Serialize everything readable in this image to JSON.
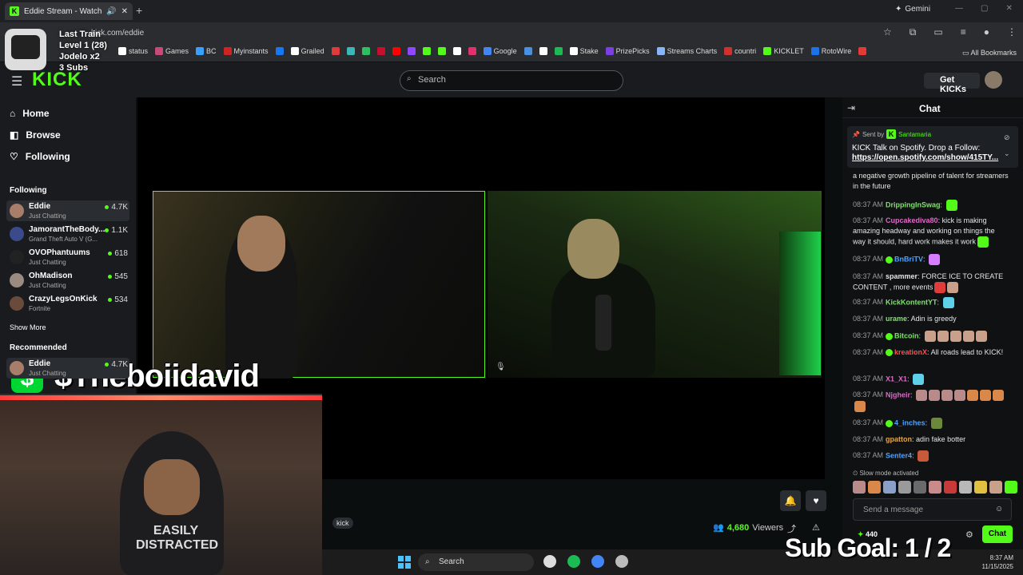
{
  "browser": {
    "tab_title": "Eddie Stream - Watch Live ...",
    "url": "kick.com/eddie",
    "gemini": "Gemini",
    "all_bookmarks": "All Bookmarks",
    "bookmarks": [
      {
        "label": "status",
        "color": "#ffffff"
      },
      {
        "label": "Games",
        "color": "#c84a7a"
      },
      {
        "label": "BC",
        "color": "#3aa0ff"
      },
      {
        "label": "Myinstants",
        "color": "#d02424"
      },
      {
        "label": "",
        "color": "#1877f2"
      },
      {
        "label": "Grailed",
        "color": "#ffffff"
      },
      {
        "label": "",
        "color": "#e03b3b"
      },
      {
        "label": "",
        "color": "#3ab8b8"
      },
      {
        "label": "",
        "color": "#2cc060"
      },
      {
        "label": "",
        "color": "#c8102e"
      },
      {
        "label": "",
        "color": "#ff0000"
      },
      {
        "label": "",
        "color": "#9146ff"
      },
      {
        "label": "",
        "color": "#53fc18"
      },
      {
        "label": "",
        "color": "#53fc18"
      },
      {
        "label": "",
        "color": "#ffffff"
      },
      {
        "label": "",
        "color": "#e1306c"
      },
      {
        "label": "Google",
        "color": "#4285f4"
      },
      {
        "label": "",
        "color": "#4a90e2"
      },
      {
        "label": "",
        "color": "#ffffff"
      },
      {
        "label": "",
        "color": "#1db954"
      },
      {
        "label": "Stake",
        "color": "#ffffff"
      },
      {
        "label": "PrizePicks",
        "color": "#7b3fe4"
      },
      {
        "label": "Streams Charts",
        "color": "#8ab4f8"
      },
      {
        "label": "countri",
        "color": "#d0312d"
      },
      {
        "label": "KICKLET",
        "color": "#53fc18"
      },
      {
        "label": "RotoWire",
        "color": "#1a73e8"
      },
      {
        "label": "",
        "color": "#e53935"
      }
    ]
  },
  "overlay": {
    "line1": "Last Train",
    "line2": "Level 1  (28)",
    "line3": "Jodelo x2",
    "line4": "3 Subs",
    "cashtag_symbol": "$",
    "cashtag": "$Theboiidavid",
    "subgoal": "Sub Goal:  1 / 2",
    "shirt": "EASILY DISTRACTED"
  },
  "header": {
    "logo": "KICK",
    "search_placeholder": "Search",
    "get_kicks": "Get KICKs"
  },
  "sidebar": {
    "nav": [
      {
        "label": "Home",
        "icon": "⌂"
      },
      {
        "label": "Browse",
        "icon": "◧"
      },
      {
        "label": "Following",
        "icon": "♡"
      }
    ],
    "following_title": "Following",
    "following": [
      {
        "name": "Eddie",
        "category": "Just Chatting",
        "viewers": "4.7K",
        "color": "#a87d6a"
      },
      {
        "name": "JamorantTheBody...",
        "category": "Grand Theft Auto V (G...",
        "viewers": "1.1K",
        "color": "#3a4a8a"
      },
      {
        "name": "OVOPhantuums",
        "category": "Just Chatting",
        "viewers": "618",
        "color": "#222"
      },
      {
        "name": "OhMadison",
        "category": "Just Chatting",
        "viewers": "545",
        "color": "#9a8a80"
      },
      {
        "name": "CrazyLegsOnKick",
        "category": "Fortnite",
        "viewers": "534",
        "color": "#6a4a3a"
      }
    ],
    "show_more": "Show More",
    "recommended_title": "Recommended",
    "recommended": [
      {
        "name": "Eddie",
        "category": "Just Chatting",
        "viewers": "4.7K",
        "color": "#a87d6a"
      }
    ]
  },
  "stream": {
    "tag": "kick",
    "viewers": "4,680",
    "viewers_label": "Viewers"
  },
  "chat": {
    "title": "Chat",
    "pinned": {
      "sent_by": "Sent by",
      "user": "Santamaria",
      "message": "KICK Talk on Spotify. Drop a Follow:",
      "link": "https://open.spotify.com/show/415TY..."
    },
    "messages": [
      {
        "time": "08:37 AM",
        "user": "",
        "color": "#ccc",
        "text": "a negative growth pipeline of talent for streamers in the future",
        "badge": false,
        "emotes": []
      },
      {
        "time": "08:37 AM",
        "user": "DrippingInSwag",
        "color": "#7ee36a",
        "text": "",
        "badge": false,
        "emotes": [
          "#53fc18"
        ]
      },
      {
        "time": "08:37 AM",
        "user": "Cupcakediva80",
        "color": "#e067c9",
        "text": "kick is making amazing headway and working on things the way it should, hard work makes it work",
        "badge": false,
        "emotes": [
          "#53fc18"
        ]
      },
      {
        "time": "08:37 AM",
        "user": "BnBriTV",
        "color": "#4fa3ff",
        "text": "",
        "badge": true,
        "emotes": [
          "#d67cff"
        ]
      },
      {
        "time": "08:37 AM",
        "user": "spammer",
        "color": "#e6e6e6",
        "text": "FORCE ICE TO CREATE CONTENT , more events",
        "badge": false,
        "emotes": [
          "#e03b3b",
          "#c9a08a"
        ]
      },
      {
        "time": "08:37 AM",
        "user": "KickKontentYT",
        "color": "#7ee36a",
        "text": "",
        "badge": false,
        "emotes": [
          "#5ed1e8"
        ]
      },
      {
        "time": "08:37 AM",
        "user": "urame",
        "color": "#7ee36a",
        "text": "Adin is greedy",
        "badge": false,
        "emotes": []
      },
      {
        "time": "08:37 AM",
        "user": "Bitcoin",
        "color": "#7ee36a",
        "text": "",
        "badge": true,
        "emotes": [
          "#c9a08a",
          "#c9a08a",
          "#c9a08a",
          "#c9a08a",
          "#c9a08a"
        ]
      },
      {
        "time": "08:37 AM",
        "user": "kreationX",
        "color": "#ff4d4d",
        "text": "All roads lead to KICK!",
        "badge": true,
        "emotes": []
      },
      {
        "time": "08:37 AM",
        "user": "X1_X1",
        "color": "#e067c9",
        "text": "",
        "badge": false,
        "emotes": [
          "#5ed1e8"
        ]
      },
      {
        "time": "08:37 AM",
        "user": "Njgheir",
        "color": "#e067c9",
        "text": "",
        "badge": false,
        "emotes": [
          "#b88a8a",
          "#b88a8a",
          "#b88a8a",
          "#b88a8a",
          "#d9884a",
          "#d9884a",
          "#d9884a",
          "#d9884a"
        ]
      },
      {
        "time": "08:37 AM",
        "user": "4_inches",
        "color": "#4fa3ff",
        "text": "",
        "badge": true,
        "emotes": [
          "#6a8a3a"
        ]
      },
      {
        "time": "08:37 AM",
        "user": "gpatton",
        "color": "#e0a84a",
        "text": "adin fake botter",
        "badge": false,
        "emotes": []
      },
      {
        "time": "08:37 AM",
        "user": "Senter4",
        "color": "#4fa3ff",
        "text": "",
        "badge": false,
        "emotes": [
          "#c85a3a"
        ]
      }
    ],
    "slow_mode": "Slow mode activated",
    "emote_bar": [
      "#b88a8a",
      "#d9884a",
      "#8aa0c8",
      "#9a9a9a",
      "#6a6a6a",
      "#c88a8a",
      "#c83a3a",
      "#b8b8b8",
      "#e0c040",
      "#c9a08a",
      "#53fc18"
    ],
    "send_placeholder": "Send a message",
    "points": "440",
    "chat_button": "Chat"
  },
  "taskbar": {
    "search": "Search",
    "time": "8:37 AM",
    "date": "11/15/2025",
    "icons": [
      "#dddddd",
      "#1db954",
      "#4285f4",
      "#bbbbbb"
    ]
  }
}
